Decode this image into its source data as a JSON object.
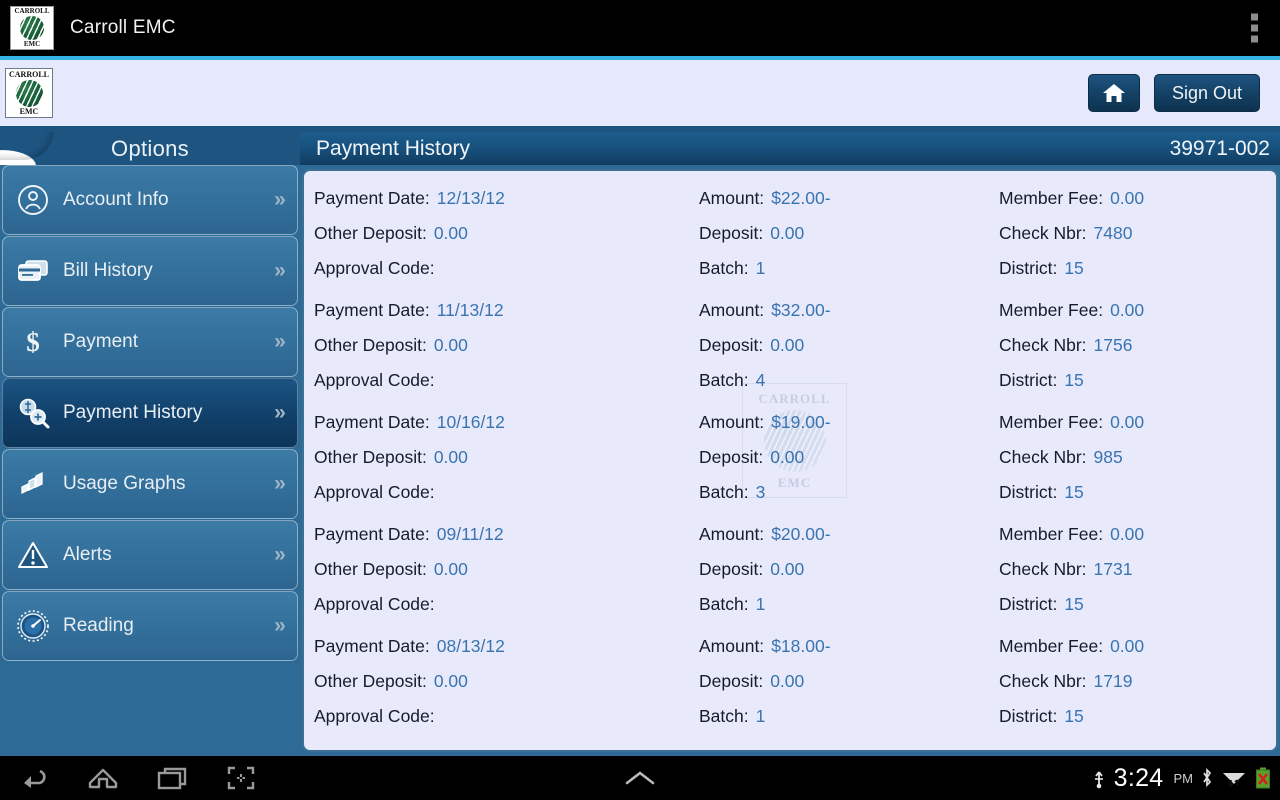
{
  "actionbar": {
    "title": "Carroll EMC",
    "logo_top": "CARROLL",
    "logo_bottom": "EMC",
    "overflow_icon": "overflow-menu-icon",
    "accent_color": "#33b5e5"
  },
  "subheader": {
    "logo_top": "CARROLL",
    "logo_bottom": "EMC",
    "home_icon": "home-icon",
    "signout_label": "Sign Out"
  },
  "sidebar": {
    "header": "Options",
    "items": [
      {
        "label": "Account Info",
        "icon": "user-circle-icon",
        "chevron": "»",
        "selected": false
      },
      {
        "label": "Bill History",
        "icon": "credit-cards-icon",
        "chevron": "»",
        "selected": false
      },
      {
        "label": "Payment",
        "icon": "dollar-sign-icon",
        "chevron": "»",
        "selected": false
      },
      {
        "label": "Payment History",
        "icon": "payment-search-icon",
        "chevron": "»",
        "selected": true
      },
      {
        "label": "Usage Graphs",
        "icon": "bar-chart-icon",
        "chevron": "»",
        "selected": false
      },
      {
        "label": "Alerts",
        "icon": "warning-triangle-icon",
        "chevron": "»",
        "selected": false
      },
      {
        "label": "Reading",
        "icon": "meter-gauge-icon",
        "chevron": "»",
        "selected": false
      }
    ]
  },
  "content": {
    "title": "Payment History",
    "account_number": "39971-002",
    "watermark": {
      "top": "CARROLL",
      "bottom": "EMC"
    },
    "labels": {
      "payment_date": "Payment Date:",
      "amount": "Amount:",
      "member_fee": "Member Fee:",
      "other_deposit": "Other Deposit:",
      "deposit": "Deposit:",
      "check_nbr": "Check Nbr:",
      "approval_code": "Approval Code:",
      "batch": "Batch:",
      "district": "District:"
    },
    "records": [
      {
        "payment_date": "12/13/12",
        "amount": "$22.00-",
        "member_fee": "0.00",
        "other_deposit": "0.00",
        "deposit": "0.00",
        "check_nbr": "7480",
        "approval_code": "",
        "batch": "1",
        "district": "15"
      },
      {
        "payment_date": "11/13/12",
        "amount": "$32.00-",
        "member_fee": "0.00",
        "other_deposit": "0.00",
        "deposit": "0.00",
        "check_nbr": "1756",
        "approval_code": "",
        "batch": "4",
        "district": "15"
      },
      {
        "payment_date": "10/16/12",
        "amount": "$19.00-",
        "member_fee": "0.00",
        "other_deposit": "0.00",
        "deposit": "0.00",
        "check_nbr": "985",
        "approval_code": "",
        "batch": "3",
        "district": "15"
      },
      {
        "payment_date": "09/11/12",
        "amount": "$20.00-",
        "member_fee": "0.00",
        "other_deposit": "0.00",
        "deposit": "0.00",
        "check_nbr": "1731",
        "approval_code": "",
        "batch": "1",
        "district": "15"
      },
      {
        "payment_date": "08/13/12",
        "amount": "$18.00-",
        "member_fee": "0.00",
        "other_deposit": "0.00",
        "deposit": "0.00",
        "check_nbr": "1719",
        "approval_code": "",
        "batch": "1",
        "district": "15"
      }
    ]
  },
  "navbar": {
    "back_icon": "back-arrow-icon",
    "home_icon": "home-outline-icon",
    "recents_icon": "recent-apps-icon",
    "screenshot_icon": "screenshot-icon",
    "expand_icon": "chevron-up-icon",
    "usb_icon": "usb-icon",
    "bluetooth_icon": "bluetooth-icon",
    "wifi_icon": "wifi-icon",
    "battery_icon": "battery-error-icon",
    "time": "3:24",
    "period": "PM"
  }
}
